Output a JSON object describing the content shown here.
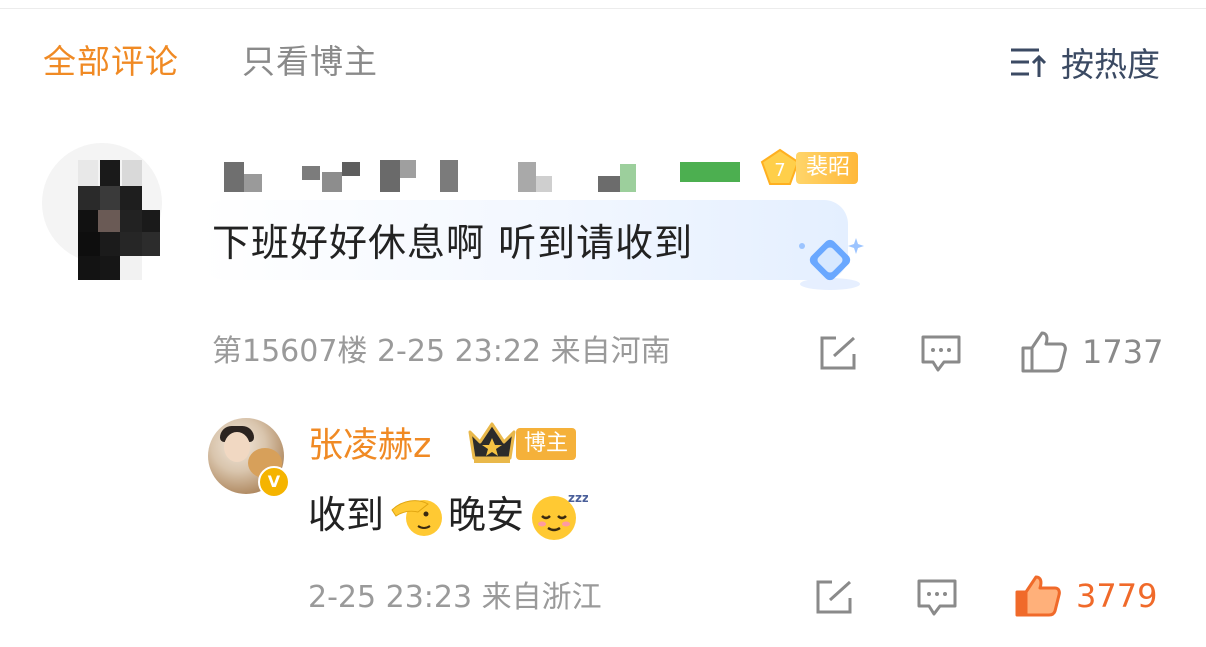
{
  "tabs": {
    "all_comments": "全部评论",
    "blogger_only": "只看博主",
    "sort_label": "按热度"
  },
  "comment": {
    "fan_level": "7",
    "fan_badge": "裴昭",
    "text": "下班好好休息啊 听到请收到",
    "meta": "第15607楼 2-25 23:22 来自河南",
    "likes": "1737"
  },
  "reply": {
    "author": "张凌赫z",
    "badge": "博主",
    "text_part1": "收到",
    "text_part2": "晚安",
    "emoji_1": "salute-emoji",
    "emoji_2": "sleepy-emoji",
    "meta": "2-25 23:23 来自浙江",
    "likes": "3779"
  },
  "colors": {
    "accent": "#f08a24",
    "like_active": "#f06a2a",
    "meta_gray": "#9a9a9a"
  }
}
